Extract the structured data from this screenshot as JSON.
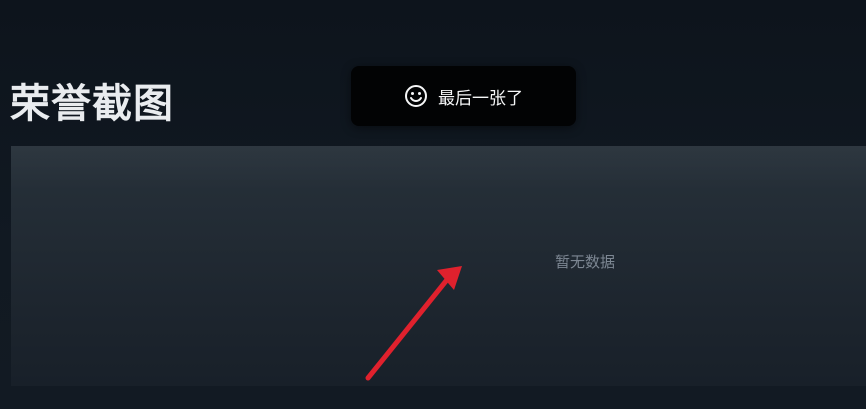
{
  "section": {
    "title": "荣誉截图"
  },
  "screenshots_panel": {
    "empty_text": "暂无数据"
  },
  "toast": {
    "icon": "smile-icon",
    "message": "最后一张了"
  },
  "annotation": {
    "icon": "red-arrow",
    "color": "#e0212d"
  }
}
